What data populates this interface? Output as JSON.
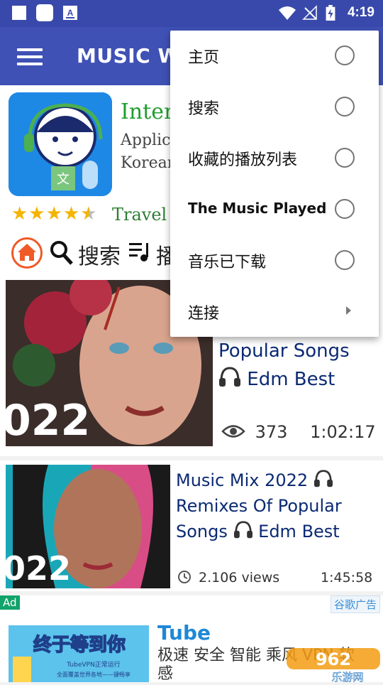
{
  "status_bar": {
    "time": "4:19",
    "icons": [
      "square-icon",
      "rounded-square-icon",
      "font-icon",
      "wifi-icon",
      "no-signal-icon",
      "battery-charging-icon"
    ]
  },
  "app_bar": {
    "title": "MUSIC WO",
    "menu_icon": "hamburger-icon",
    "color": "#3f51b5"
  },
  "ad_banner": {
    "app_name": "Interpr",
    "description_lines": [
      "Applica",
      "Korean"
    ],
    "rating_stars": 4.5,
    "category": "Travel"
  },
  "nav": {
    "search_label": "搜索",
    "play_label": "播",
    "accent": "#ef5a28"
  },
  "videos": [
    {
      "title_line1": "Popular Songs",
      "title_line2": "Edm Best",
      "views": "373",
      "duration": "1:02:17",
      "thumb_text": "022"
    },
    {
      "title_line1": "Music Mix 2022",
      "title_line2": "Remixes Of Popular",
      "title_line3": "Songs",
      "title_line3b": "Edm Best",
      "views": "2.106 views",
      "duration": "1:45:58",
      "thumb_text": "022"
    }
  ],
  "ad2": {
    "label": "Ad",
    "provider": "谷歌广告",
    "title": "Tube",
    "description_line1": "极速 安全 智能 乘风 VPN 软",
    "description_line2": "感",
    "thumb_text": "终于等到你",
    "thumb_subtext": "TubeVPN正常运行",
    "thumb_subtext2": "全面覆盖世界各地——键畅享"
  },
  "watermark": {
    "text": "962",
    "subtext": "乐游网"
  },
  "menu": {
    "items": [
      {
        "label": "主页",
        "type": "radio"
      },
      {
        "label": "搜索",
        "type": "radio"
      },
      {
        "label": "收藏的播放列表",
        "type": "radio"
      },
      {
        "label": "The Music Played",
        "type": "radio"
      },
      {
        "label": "音乐已下载",
        "type": "radio"
      },
      {
        "label": "连接",
        "type": "submenu"
      }
    ]
  }
}
